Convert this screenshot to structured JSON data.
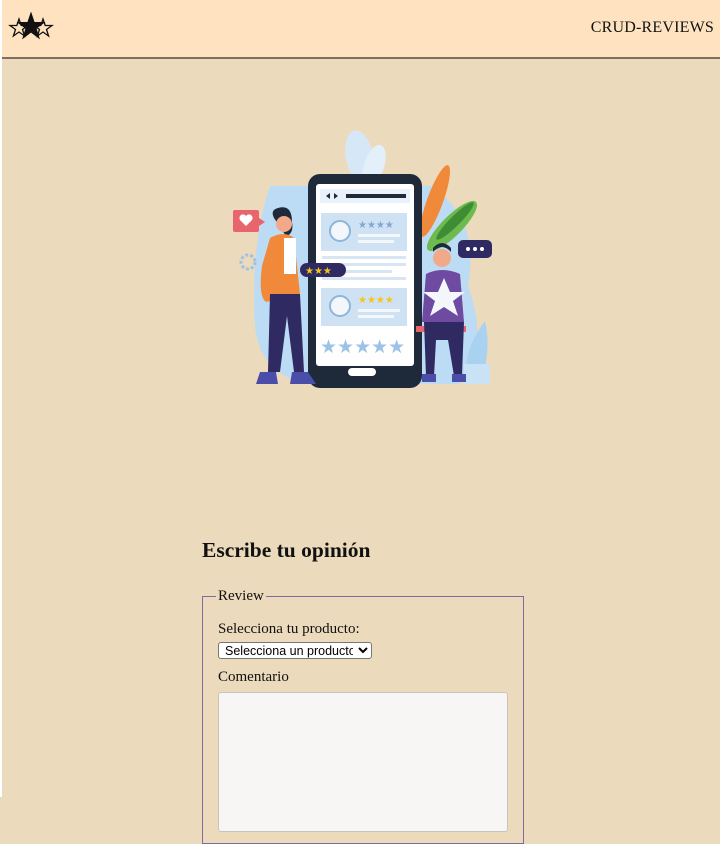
{
  "header": {
    "logo_icon": "stars-icon",
    "brand": "CRUD-REVIEWS"
  },
  "hero": {
    "illustration": "reviews-phone-illustration",
    "icon_colors": {
      "star": "#f5c518",
      "accent": "#2f2b62",
      "heart": "#e8656d"
    }
  },
  "form_section": {
    "title": "Escribe tu opinión",
    "legend": "Review",
    "product_label": "Selecciona tu producto:",
    "product_select": {
      "selected": "Selecciona un producto"
    },
    "comment_label": "Comentario",
    "comment_value": ""
  },
  "colors": {
    "header_bg": "#ffe3c1",
    "page_bg": "#ecdabd",
    "fieldset_border": "#7e6a9e"
  }
}
